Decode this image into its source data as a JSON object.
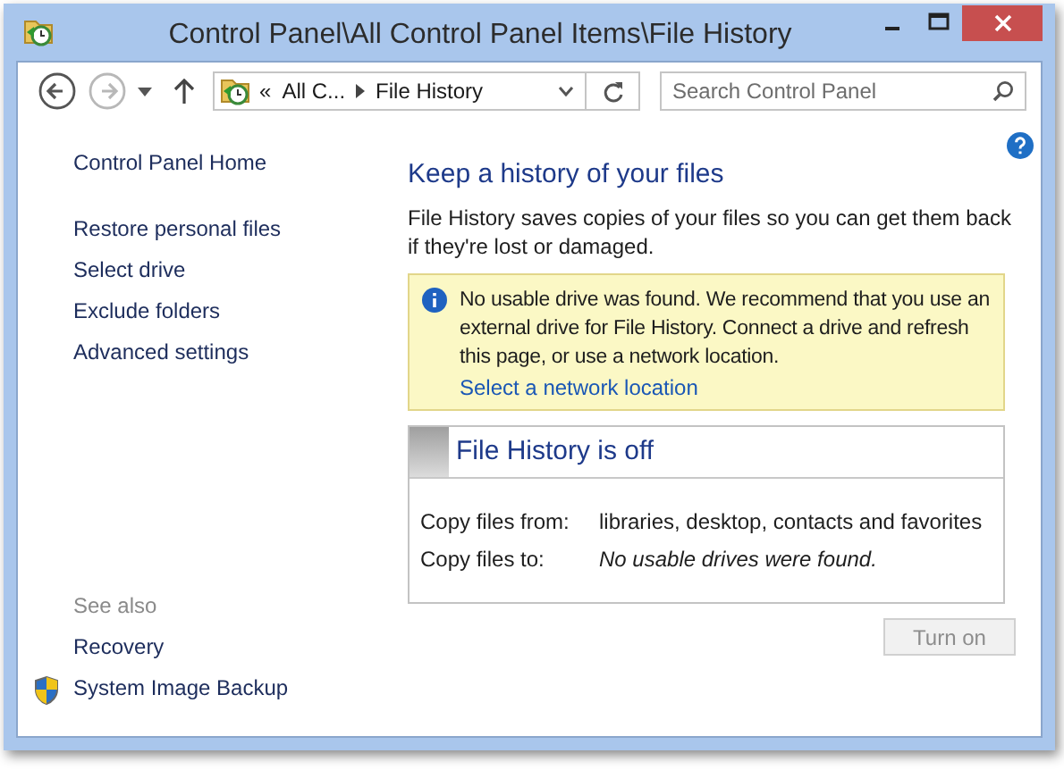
{
  "window": {
    "title": "Control Panel\\All Control Panel Items\\File History"
  },
  "navigation": {
    "back": {
      "disabled": false
    },
    "forward": {
      "disabled": true
    }
  },
  "address": {
    "overflow": "«",
    "crumbs": [
      "All C...",
      "File History"
    ]
  },
  "search": {
    "placeholder": "Search Control Panel"
  },
  "sidebar": {
    "items": [
      {
        "label": "Control Panel Home",
        "kind": "home"
      },
      {
        "label": "Restore personal files",
        "kind": "task"
      },
      {
        "label": "Select drive",
        "kind": "task"
      },
      {
        "label": "Exclude folders",
        "kind": "task"
      },
      {
        "label": "Advanced settings",
        "kind": "task"
      }
    ],
    "see_also": {
      "heading": "See also",
      "items": [
        {
          "label": "Recovery",
          "kind": "link"
        },
        {
          "label": "System Image Backup",
          "kind": "shield"
        }
      ]
    }
  },
  "main": {
    "heading": "Keep a history of your files",
    "description": "File History saves copies of your files so you can get them back if they're lost or damaged.",
    "notice": {
      "message": "No usable drive was found. We recommend that you use an external drive for File History. Connect a drive and refresh this page, or use a network location.",
      "link": "Select a network location"
    },
    "status": {
      "title": "File History is off",
      "rows": [
        {
          "label": "Copy files from:",
          "value": "libraries, desktop, contacts and favorites",
          "kind": "plain"
        },
        {
          "label": "Copy files to:",
          "value": "No usable drives were found.",
          "kind": "italic"
        }
      ]
    },
    "button": {
      "label": "Turn on",
      "disabled": true
    }
  }
}
